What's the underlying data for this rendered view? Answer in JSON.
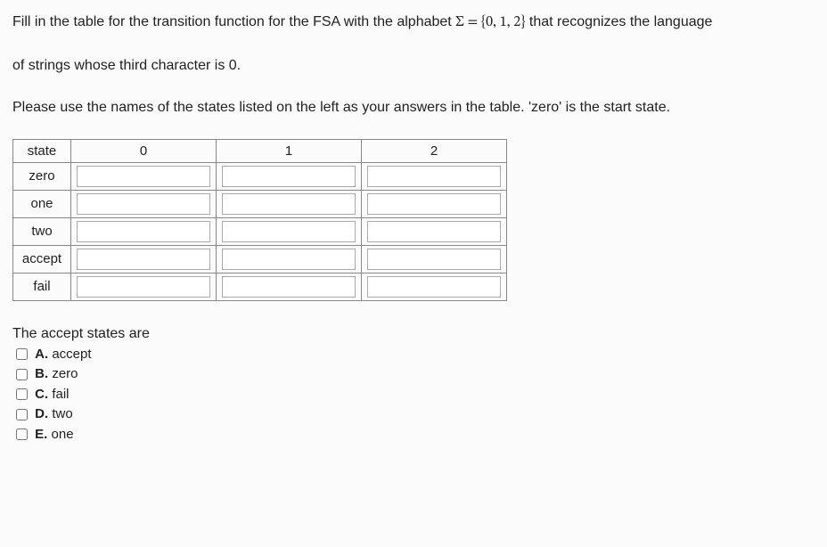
{
  "prompt": {
    "line1_a": "Fill in the table for the transition function for the FSA with the alphabet ",
    "line1_sigma": "Σ = {0, 1, 2}",
    "line1_b": " that recognizes the language",
    "line2": "of strings whose third character is 0.",
    "line3": "Please use the names of the states listed on the left as your answers in the table. 'zero' is the start state."
  },
  "table": {
    "header_state": "state",
    "columns": [
      "0",
      "1",
      "2"
    ],
    "rows": [
      "zero",
      "one",
      "two",
      "accept",
      "fail"
    ]
  },
  "accept_question": {
    "stem": "The accept states are",
    "options": [
      {
        "letter": "A.",
        "text": "accept"
      },
      {
        "letter": "B.",
        "text": "zero"
      },
      {
        "letter": "C.",
        "text": "fail"
      },
      {
        "letter": "D.",
        "text": "two"
      },
      {
        "letter": "E.",
        "text": "one"
      }
    ]
  }
}
